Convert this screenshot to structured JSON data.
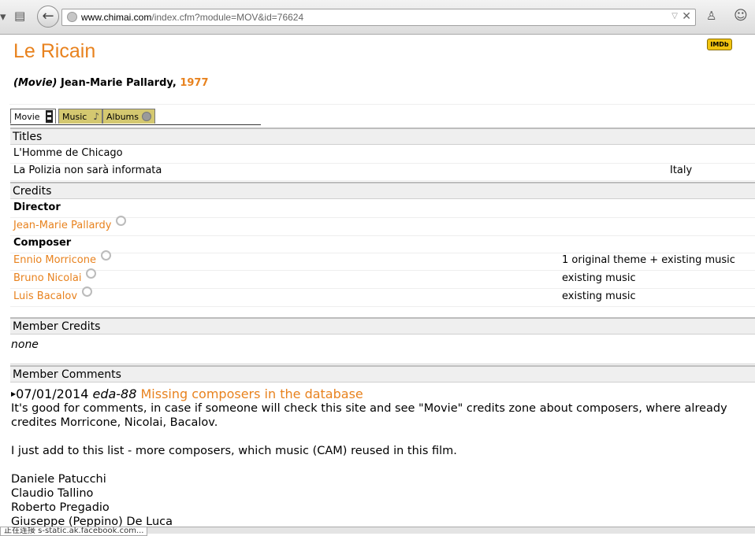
{
  "browser": {
    "url_host": "www.chimai.com",
    "url_path": "/index.cfm?module=MOV&id=76624",
    "status_text": "正在连接 s-static.ak.facebook.com..."
  },
  "movie": {
    "title": "Le Ricain",
    "type_label": "(Movie)",
    "director": "Jean-Marie Pallardy,",
    "year": "1977",
    "imdb_badge": "IMDb"
  },
  "tabs": [
    "Movie",
    "Music",
    "Albums"
  ],
  "titles_section": {
    "header": "Titles",
    "rows": [
      {
        "name": "L'Homme de Chicago",
        "country": ""
      },
      {
        "name": "La Polizia non sarà informata",
        "country": "Italy"
      }
    ]
  },
  "credits_section": {
    "header": "Credits",
    "director_label": "Director",
    "director_name": "Jean-Marie Pallardy",
    "composer_label": "Composer",
    "composers": [
      {
        "name": "Ennio Morricone",
        "note": "1 original theme + existing music"
      },
      {
        "name": "Bruno Nicolai",
        "note": "existing music"
      },
      {
        "name": "Luis Bacalov",
        "note": "existing music"
      }
    ]
  },
  "member_credits": {
    "header": "Member Credits",
    "value": "none"
  },
  "member_comments": {
    "header": "Member Comments",
    "date": "07/01/2014",
    "user": "eda-88",
    "title": "Missing composers in the database",
    "lines": [
      "It's good for comments, in case if someone will check this site and see \"Movie\" credits zone about composers, where already credites Morricone, Nicolai, Bacalov.",
      "",
      "I just add to this list - more composers, which music (CAM) reused in this film.",
      "",
      "Daniele Patucchi",
      "Claudio Tallino",
      "Roberto Pregadio",
      "Giuseppe (Peppino) De Luca"
    ]
  },
  "colors": {
    "accent": "#e8821e",
    "tab_inactive": "#d4c870",
    "section_header_bg": "#efefef"
  }
}
